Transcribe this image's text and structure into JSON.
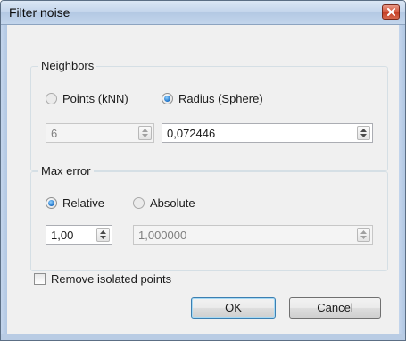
{
  "window": {
    "title": "Filter noise"
  },
  "neighbors": {
    "legend": "Neighbors",
    "options": [
      {
        "label": "Points (kNN)",
        "selected": false
      },
      {
        "label": "Radius (Sphere)",
        "selected": true
      }
    ],
    "knn_value": "6",
    "radius_value": "0,072446"
  },
  "max_error": {
    "legend": "Max error",
    "options": [
      {
        "label": "Relative",
        "selected": true
      },
      {
        "label": "Absolute",
        "selected": false
      }
    ],
    "relative_value": "1,00",
    "absolute_value": "1,000000"
  },
  "remove_isolated": {
    "label": "Remove isolated points",
    "checked": false
  },
  "buttons": {
    "ok": "OK",
    "cancel": "Cancel"
  },
  "icons": {
    "close": "close-icon",
    "spin": "spin-arrows-icon"
  },
  "colors": {
    "titlebar": "#c5d6ec",
    "close_button": "#c23b22",
    "radio_selected": "#1b6fc5"
  }
}
